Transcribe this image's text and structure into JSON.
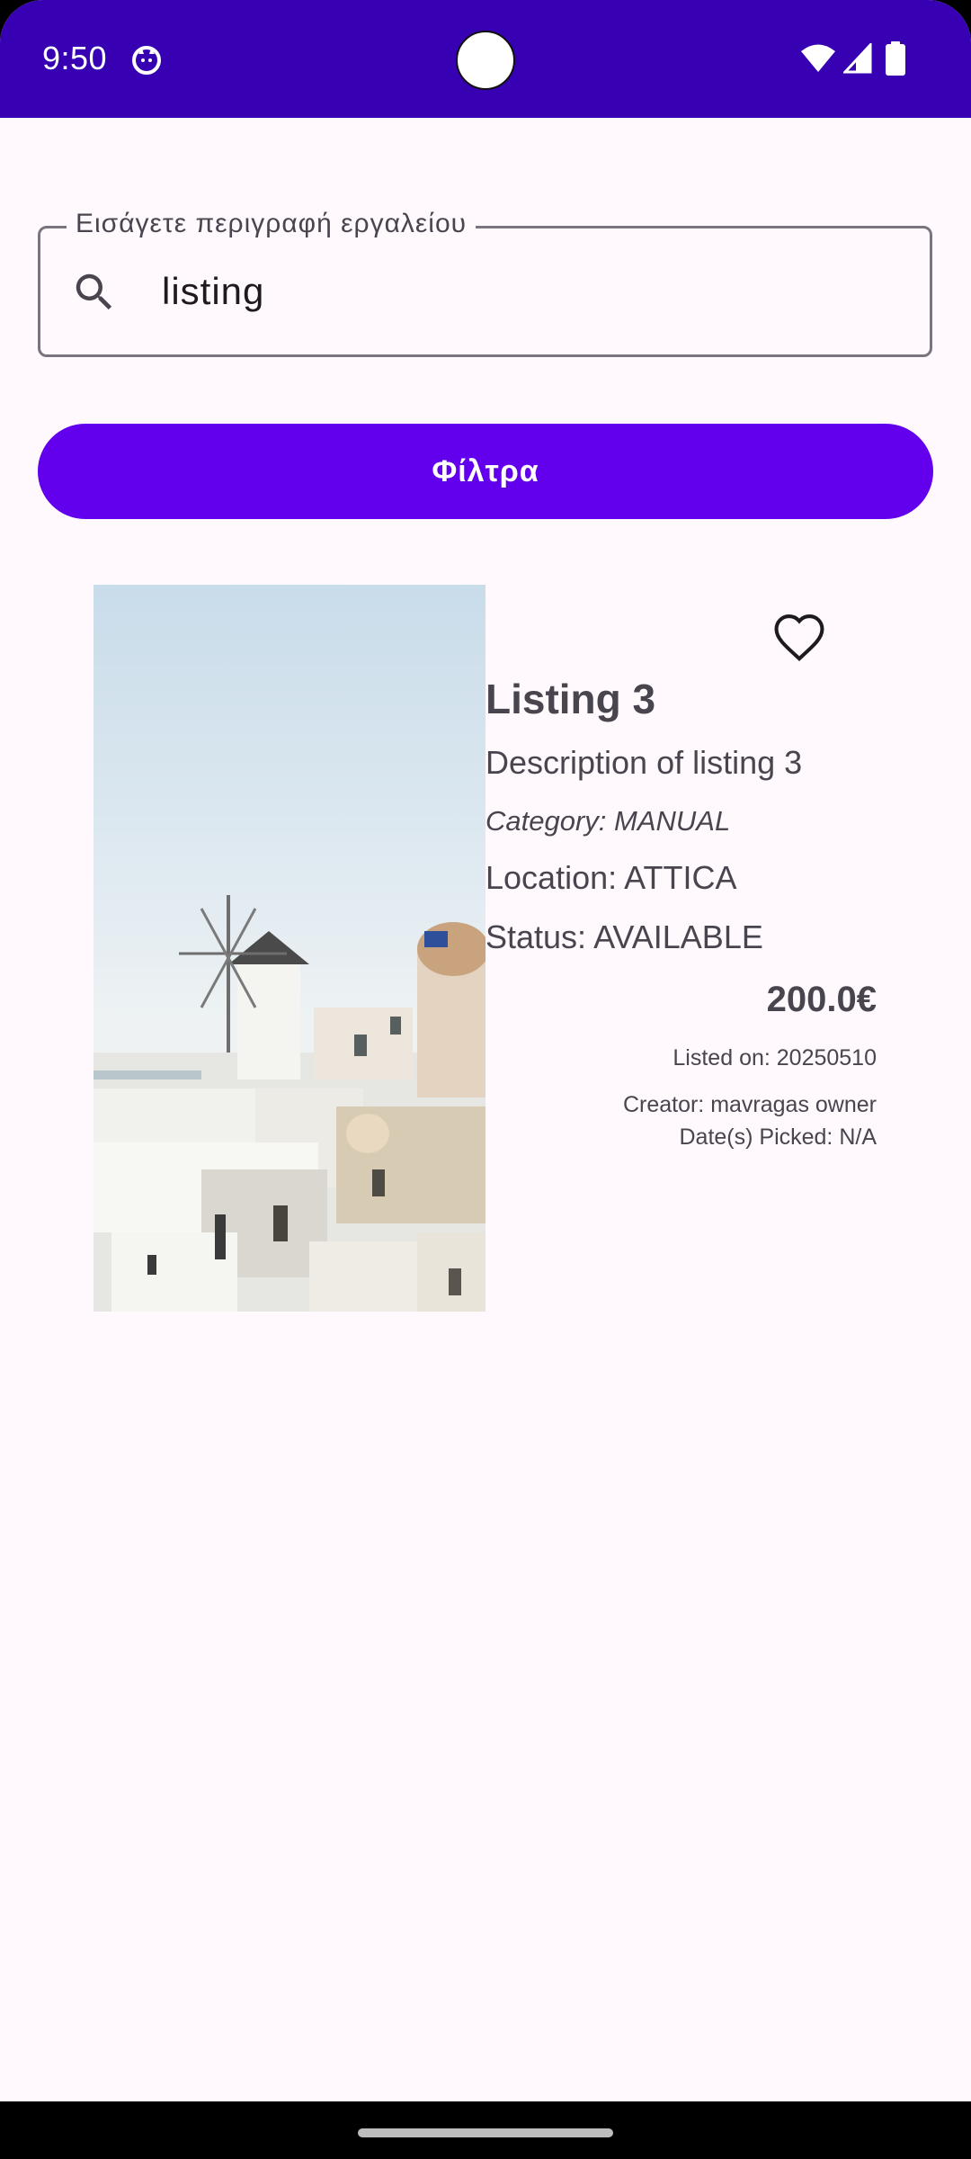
{
  "status_bar": {
    "time": "9:50",
    "app_icon": "cat-face-icon",
    "icons": [
      "wifi-icon",
      "signal-icon",
      "battery-icon"
    ],
    "background": "#3700B3"
  },
  "search": {
    "label": "Εισάγετε περιγραφή εργαλείου",
    "value": "listing",
    "icon": "search-icon"
  },
  "filters_button": {
    "label": "Φίλτρα",
    "color": "#6200EE"
  },
  "listing": {
    "title": "Listing 3",
    "description": "Description of listing 3",
    "category": "Category: MANUAL",
    "location": "Location: ATTICA",
    "status": "Status: AVAILABLE",
    "price": "200.0€",
    "listed_on": "Listed on: 20250510",
    "creator": "Creator: mavragas owner",
    "dates_picked": "Date(s) Picked: N/A",
    "favorite_icon": "heart-outline-icon",
    "image": "santorini-windmill-photo"
  }
}
